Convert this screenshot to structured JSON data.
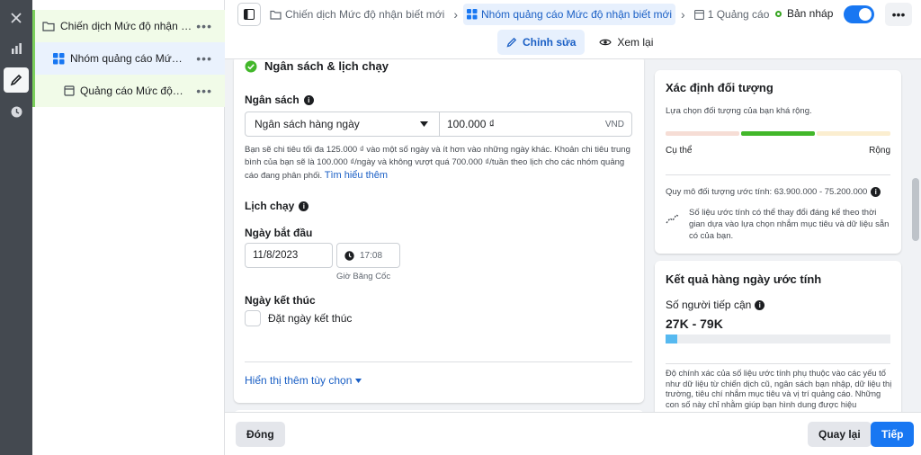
{
  "tree": {
    "items": [
      {
        "label": "Chiến dịch Mức độ nhận bi..."
      },
      {
        "label": "Nhóm quảng cáo Mức đ..."
      },
      {
        "label": "Quảng cáo Mức độ nh..."
      }
    ],
    "more": "•••"
  },
  "breadcrumb": {
    "campaign": "Chiến dịch Mức độ nhận biết mới",
    "adset": "Nhóm quảng cáo Mức độ nhận biết mới",
    "ad": "1 Quảng cáo"
  },
  "status": {
    "label": "Bản nháp"
  },
  "more_label": "•••",
  "tabs": {
    "edit": "Chỉnh sửa",
    "review": "Xem lại"
  },
  "budget_section": {
    "title": "Ngân sách & lịch chạy",
    "budget_label": "Ngân sách",
    "budget_type": "Ngân sách hàng ngày",
    "budget_amount": "100.000 ₫",
    "currency": "VND",
    "description": "Bạn sẽ chi tiêu tối đa 125.000 ₫ vào một số ngày và ít hơn vào những ngày khác. Khoản chi tiêu trung bình của bạn sẽ là 100.000 ₫/ngày và không vượt quá 700.000 ₫/tuần theo lịch cho các nhóm quảng cáo đang phân phối.",
    "learn_more": "Tìm hiểu thêm",
    "schedule_label": "Lịch chạy",
    "start_label": "Ngày bắt đầu",
    "start_date": "11/8/2023",
    "start_time": "17:08",
    "timezone": "Giờ Băng Cốc",
    "end_label": "Ngày kết thúc",
    "end_checkbox": "Đặt ngày kết thúc",
    "more_options": "Hiển thị thêm tùy chọn"
  },
  "audience": {
    "title": "Xác định đối tượng",
    "subtitle": "Lựa chọn đối tượng của bạn khá rộng.",
    "left": "Cụ thể",
    "right": "Rộng",
    "size": "Quy mô đối tượng ước tính: 63.900.000 - 75.200.000",
    "note": "Số liệu ước tính có thể thay đổi đáng kể theo thời gian dựa vào lựa chọn nhắm mục tiêu và dữ liệu sẵn có của bạn."
  },
  "results": {
    "title": "Kết quả hàng ngày ước tính",
    "reach_label": "Số người tiếp cận",
    "reach": "27K - 79K",
    "reach_fill": 0.05,
    "note": "Độ chính xác của số liệu ước tính phụ thuộc vào các yếu tố như dữ liệu từ chiến dịch cũ, ngân sách bạn nhập, dữ liệu thị trường, tiêu chí nhắm mục tiêu và vị trí quảng cáo. Những con số này chỉ nhằm giúp bạn hình dung được hiệu"
  },
  "footer": {
    "close": "Đóng",
    "back": "Quay lại",
    "next": "Tiếp"
  },
  "colors": {
    "accent": "#1877f2",
    "green": "#42b72a",
    "link": "#1a5fc5"
  }
}
